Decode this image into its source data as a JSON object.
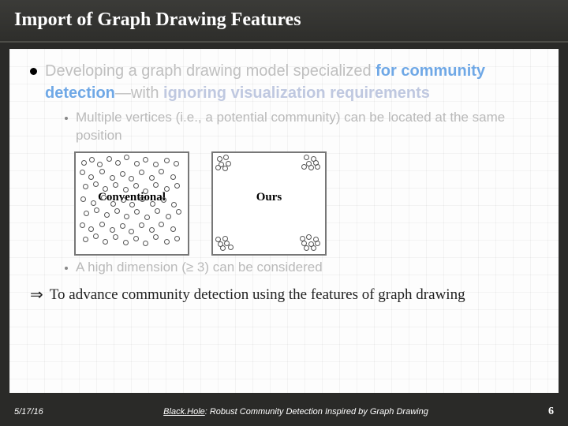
{
  "title": "Import of Graph Drawing Features",
  "bullet": {
    "prefix": "Developing a graph drawing model specialized ",
    "em1": "for community detection",
    "mid": "—with ",
    "em2": "ignoring visualization requirements"
  },
  "sub1": "Multiple vertices (i.e., a potential community) can be located at the same position",
  "figs": {
    "left_label": "Conventional",
    "right_label": "Ours"
  },
  "sub2": "A high dimension (≥ 3) can be considered",
  "conclusion_arrow": "⇒",
  "conclusion": "To advance community detection using the features of graph drawing",
  "footer": {
    "date": "5/17/16",
    "paper_name": "Black.Hole",
    "paper_rest": ": Robust Community Detection Inspired by Graph Drawing",
    "page": "6"
  },
  "chart_data": [
    {
      "type": "scatter",
      "title": "Conventional",
      "note": "uniformly scattered points across box",
      "xrange": [
        0,
        1
      ],
      "yrange": [
        0,
        1
      ],
      "points": [
        [
          0.08,
          0.1
        ],
        [
          0.15,
          0.07
        ],
        [
          0.22,
          0.12
        ],
        [
          0.3,
          0.06
        ],
        [
          0.38,
          0.1
        ],
        [
          0.46,
          0.05
        ],
        [
          0.55,
          0.11
        ],
        [
          0.63,
          0.07
        ],
        [
          0.72,
          0.12
        ],
        [
          0.82,
          0.08
        ],
        [
          0.9,
          0.11
        ],
        [
          0.06,
          0.2
        ],
        [
          0.14,
          0.24
        ],
        [
          0.24,
          0.19
        ],
        [
          0.33,
          0.25
        ],
        [
          0.42,
          0.21
        ],
        [
          0.5,
          0.26
        ],
        [
          0.59,
          0.2
        ],
        [
          0.68,
          0.25
        ],
        [
          0.77,
          0.19
        ],
        [
          0.87,
          0.24
        ],
        [
          0.09,
          0.34
        ],
        [
          0.18,
          0.31
        ],
        [
          0.27,
          0.36
        ],
        [
          0.36,
          0.32
        ],
        [
          0.45,
          0.37
        ],
        [
          0.54,
          0.33
        ],
        [
          0.63,
          0.38
        ],
        [
          0.72,
          0.32
        ],
        [
          0.82,
          0.36
        ],
        [
          0.91,
          0.33
        ],
        [
          0.07,
          0.46
        ],
        [
          0.16,
          0.5
        ],
        [
          0.25,
          0.45
        ],
        [
          0.34,
          0.51
        ],
        [
          0.43,
          0.47
        ],
        [
          0.51,
          0.52
        ],
        [
          0.6,
          0.46
        ],
        [
          0.69,
          0.51
        ],
        [
          0.79,
          0.47
        ],
        [
          0.88,
          0.52
        ],
        [
          0.1,
          0.6
        ],
        [
          0.19,
          0.57
        ],
        [
          0.28,
          0.62
        ],
        [
          0.37,
          0.58
        ],
        [
          0.46,
          0.63
        ],
        [
          0.55,
          0.59
        ],
        [
          0.64,
          0.64
        ],
        [
          0.73,
          0.58
        ],
        [
          0.83,
          0.63
        ],
        [
          0.92,
          0.59
        ],
        [
          0.06,
          0.72
        ],
        [
          0.14,
          0.76
        ],
        [
          0.24,
          0.71
        ],
        [
          0.33,
          0.77
        ],
        [
          0.42,
          0.73
        ],
        [
          0.5,
          0.78
        ],
        [
          0.59,
          0.72
        ],
        [
          0.68,
          0.77
        ],
        [
          0.77,
          0.71
        ],
        [
          0.87,
          0.76
        ],
        [
          0.09,
          0.86
        ],
        [
          0.18,
          0.83
        ],
        [
          0.27,
          0.88
        ],
        [
          0.36,
          0.84
        ],
        [
          0.45,
          0.89
        ],
        [
          0.54,
          0.85
        ],
        [
          0.63,
          0.9
        ],
        [
          0.72,
          0.84
        ],
        [
          0.82,
          0.88
        ],
        [
          0.91,
          0.85
        ]
      ]
    },
    {
      "type": "scatter",
      "title": "Ours",
      "note": "points collapsed into four corner clusters",
      "xrange": [
        0,
        1
      ],
      "yrange": [
        0,
        1
      ],
      "clusters": [
        {
          "cx": 0.1,
          "cy": 0.1,
          "points": [
            [
              0.06,
              0.06
            ],
            [
              0.12,
              0.05
            ],
            [
              0.08,
              0.12
            ],
            [
              0.14,
              0.11
            ],
            [
              0.05,
              0.15
            ],
            [
              0.11,
              0.16
            ]
          ]
        },
        {
          "cx": 0.88,
          "cy": 0.1,
          "points": [
            [
              0.84,
              0.05
            ],
            [
              0.9,
              0.06
            ],
            [
              0.86,
              0.11
            ],
            [
              0.92,
              0.1
            ],
            [
              0.82,
              0.14
            ],
            [
              0.88,
              0.15
            ],
            [
              0.94,
              0.14
            ]
          ]
        },
        {
          "cx": 0.12,
          "cy": 0.9,
          "points": [
            [
              0.05,
              0.86
            ],
            [
              0.11,
              0.85
            ],
            [
              0.07,
              0.91
            ],
            [
              0.13,
              0.9
            ],
            [
              0.16,
              0.94
            ],
            [
              0.09,
              0.95
            ]
          ]
        },
        {
          "cx": 0.86,
          "cy": 0.9,
          "points": [
            [
              0.8,
              0.85
            ],
            [
              0.86,
              0.84
            ],
            [
              0.92,
              0.86
            ],
            [
              0.82,
              0.9
            ],
            [
              0.88,
              0.91
            ],
            [
              0.94,
              0.9
            ],
            [
              0.84,
              0.95
            ],
            [
              0.9,
              0.95
            ]
          ]
        }
      ]
    }
  ]
}
